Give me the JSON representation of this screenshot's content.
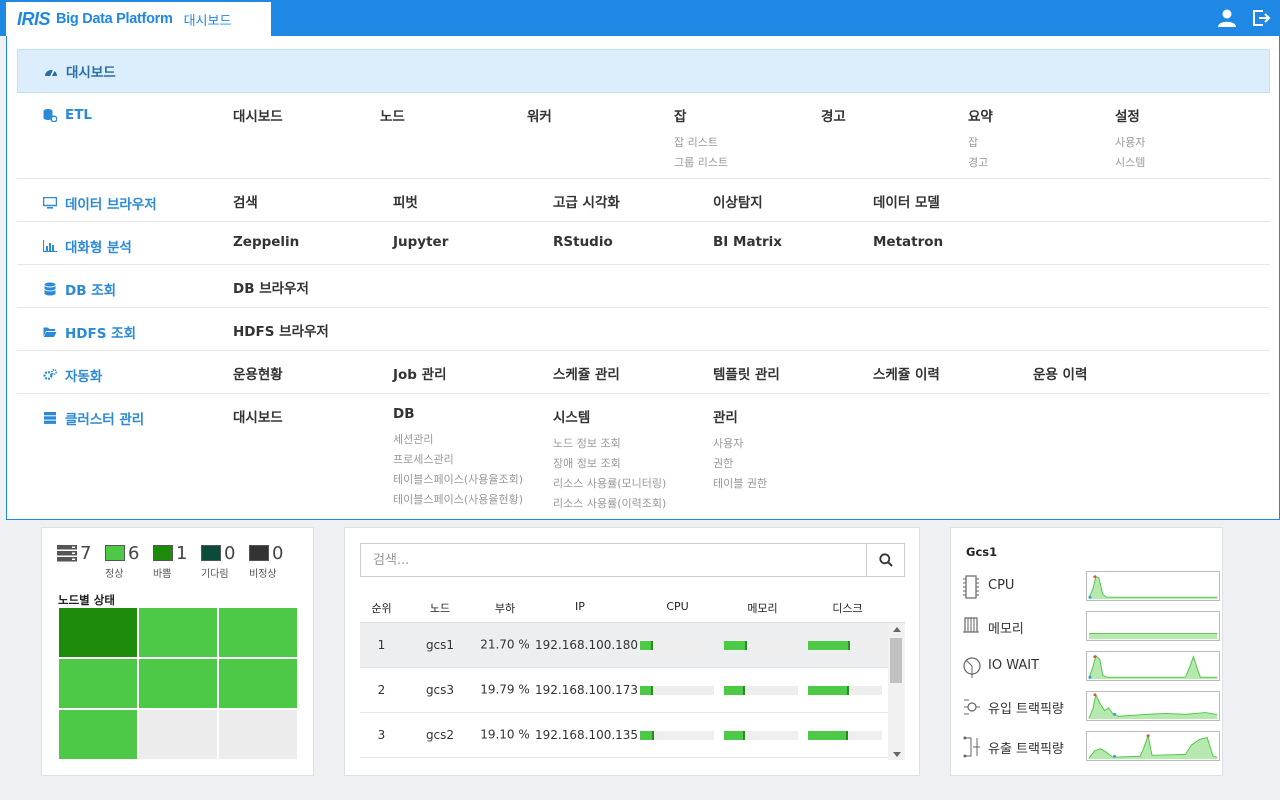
{
  "header": {
    "logo": "IRIS",
    "brand": "Big Data Platform",
    "page": "대시보드"
  },
  "menu": {
    "dashboard": "대시보드",
    "etl": {
      "label": "ETL",
      "cols": [
        {
          "title": "대시보드",
          "subs": []
        },
        {
          "title": "노드",
          "subs": []
        },
        {
          "title": "워커",
          "subs": []
        },
        {
          "title": "잡",
          "subs": [
            "잡 리스트",
            "그룹 리스트"
          ]
        },
        {
          "title": "경고",
          "subs": []
        },
        {
          "title": "요약",
          "subs": [
            "잡",
            "경고"
          ]
        },
        {
          "title": "설정",
          "subs": [
            "사용자",
            "시스템"
          ]
        }
      ]
    },
    "browser": {
      "label": "데이터 브라우저",
      "items": [
        "검색",
        "피벗",
        "고급 시각화",
        "이상탐지",
        "데이터 모델"
      ]
    },
    "analysis": {
      "label": "대화형 분석",
      "items": [
        "Zeppelin",
        "Jupyter",
        "RStudio",
        "BI Matrix",
        "Metatron"
      ]
    },
    "db": {
      "label": "DB 조회",
      "items": [
        "DB 브라우저"
      ]
    },
    "hdfs": {
      "label": "HDFS 조회",
      "items": [
        "HDFS 브라우저"
      ]
    },
    "auto": {
      "label": "자동화",
      "items": [
        "운용현황",
        "Job 관리",
        "스케쥴 관리",
        "템플릿 관리",
        "스케쥴 이력",
        "운용 이력"
      ]
    },
    "cluster": {
      "label": "클러스터 관리",
      "cols": [
        {
          "title": "대시보드",
          "subs": []
        },
        {
          "title": "DB",
          "subs": [
            "세션관리",
            "프로세스관리",
            "테이블스페이스(사용율조회)",
            "테이블스페이스(사용율현황)"
          ]
        },
        {
          "title": "시스템",
          "subs": [
            "노드 정보 조회",
            "장애 정보 조회",
            "리소스 사용률(모니터링)",
            "리소스 사용률(이력조회)"
          ]
        },
        {
          "title": "관리",
          "subs": [
            "사용자",
            "권한",
            "테이블 권한"
          ]
        }
      ]
    }
  },
  "status": {
    "total": "7",
    "items": [
      {
        "count": "6",
        "label": "정상",
        "color": "#4dc847"
      },
      {
        "count": "1",
        "label": "바쁨",
        "color": "#1e8b0a"
      },
      {
        "count": "0",
        "label": "기다림",
        "color": "#0c4a3c"
      },
      {
        "count": "0",
        "label": "비정상",
        "color": "#333333"
      }
    ],
    "heatmap_title": "노드별 상태",
    "heatmap": [
      "#1e8b0a",
      "#4dc847",
      "#4dc847",
      "#4dc847",
      "#4dc847",
      "#4dc847",
      "#4dc847",
      "#ececec",
      "#ececec"
    ]
  },
  "nodes": {
    "search_placeholder": "검색...",
    "columns": [
      "순위",
      "노드",
      "부하",
      "IP",
      "CPU",
      "메모리",
      "디스크"
    ],
    "rows": [
      {
        "rank": "1",
        "node": "gcs1",
        "load": "21.70 %",
        "ip": "192.168.100.180",
        "cpu": 0.18,
        "mem": 0.31,
        "disk": 0.57
      },
      {
        "rank": "2",
        "node": "gcs3",
        "load": "19.79 %",
        "ip": "192.168.100.173",
        "cpu": 0.18,
        "mem": 0.28,
        "disk": 0.55
      },
      {
        "rank": "3",
        "node": "gcs2",
        "load": "19.10 %",
        "ip": "192.168.100.135",
        "cpu": 0.19,
        "mem": 0.28,
        "disk": 0.54
      }
    ]
  },
  "monitor": {
    "title": "Gcs1",
    "metrics": [
      {
        "label": "CPU",
        "icon": "cpu-icon"
      },
      {
        "label": "메모리",
        "icon": "memory-icon"
      },
      {
        "label": "IO WAIT",
        "icon": "io-wait-icon"
      },
      {
        "label": "유입 트랙픽량",
        "icon": "inbound-traffic-icon"
      },
      {
        "label": "유출 트랙픽량",
        "icon": "outbound-traffic-icon"
      }
    ]
  }
}
